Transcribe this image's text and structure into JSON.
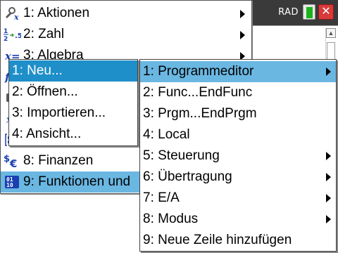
{
  "status": {
    "angle_mode": "RAD"
  },
  "main_menu": {
    "items": [
      {
        "label": "1: Aktionen",
        "icon": "actions-icon",
        "has_submenu": true
      },
      {
        "label": "2: Zahl",
        "icon": "number-icon",
        "has_submenu": true
      },
      {
        "label": "3: Algebra",
        "icon": "algebra-icon",
        "has_submenu": true
      },
      {
        "label": "",
        "icon": "calculus-icon",
        "has_submenu": false
      },
      {
        "label": "",
        "icon": "probability-icon",
        "has_submenu": false
      },
      {
        "label": "",
        "icon": "statistics-icon",
        "has_submenu": false
      },
      {
        "label": "",
        "icon": "matrix-icon",
        "has_submenu": false
      },
      {
        "label": "8: Finanzen",
        "icon": "finance-icon",
        "has_submenu": true
      },
      {
        "label": "9: Funktionen und",
        "icon": "functions-programs-icon",
        "has_submenu": true
      }
    ]
  },
  "program_submenu": {
    "items": [
      {
        "label": "1: Neu..."
      },
      {
        "label": "2: Öffnen..."
      },
      {
        "label": "3: Importieren..."
      },
      {
        "label": "4: Ansicht..."
      }
    ]
  },
  "new_submenu": {
    "items": [
      {
        "label": "1: Programmeditor",
        "has_submenu": true
      },
      {
        "label": "2: Func...EndFunc",
        "has_submenu": false
      },
      {
        "label": "3: Prgm...EndPrgm",
        "has_submenu": false
      },
      {
        "label": "4: Local",
        "has_submenu": false
      },
      {
        "label": "5: Steuerung",
        "has_submenu": true
      },
      {
        "label": "6: Übertragung",
        "has_submenu": true
      },
      {
        "label": "7: E/A",
        "has_submenu": true
      },
      {
        "label": "8: Modus",
        "has_submenu": true
      },
      {
        "label": "9: Neue Zeile hinzufügen",
        "has_submenu": false
      }
    ]
  },
  "colors": {
    "highlight_light": "#6ab7e2",
    "highlight_dark": "#1f8fc9",
    "close_red": "#d83a3a"
  }
}
